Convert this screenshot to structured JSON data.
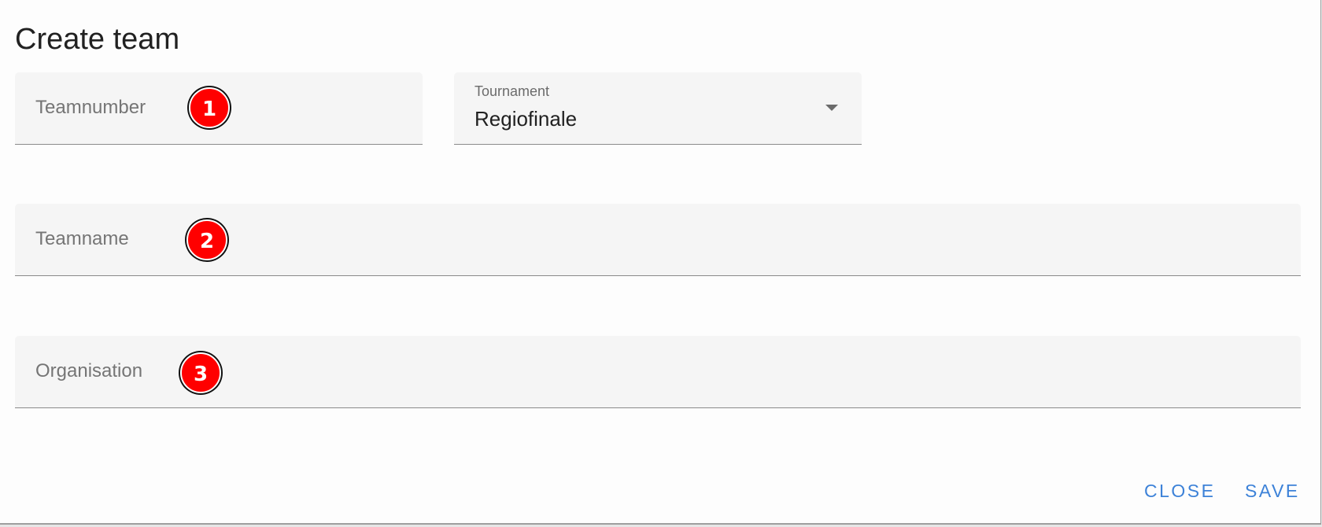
{
  "dialog": {
    "title": "Create team",
    "fields": {
      "teamnumber": {
        "placeholder": "Teamnumber",
        "value": ""
      },
      "tournament": {
        "label": "Tournament",
        "value": "Regiofinale"
      },
      "teamname": {
        "placeholder": "Teamname",
        "value": ""
      },
      "organisation": {
        "placeholder": "Organisation",
        "value": ""
      }
    },
    "badges": [
      "1",
      "2",
      "3"
    ],
    "actions": {
      "close_label": "CLOSE",
      "save_label": "SAVE"
    }
  },
  "colors": {
    "accent": "#3d82d8",
    "badge": "#ff0000",
    "field_background": "#f5f5f5"
  }
}
